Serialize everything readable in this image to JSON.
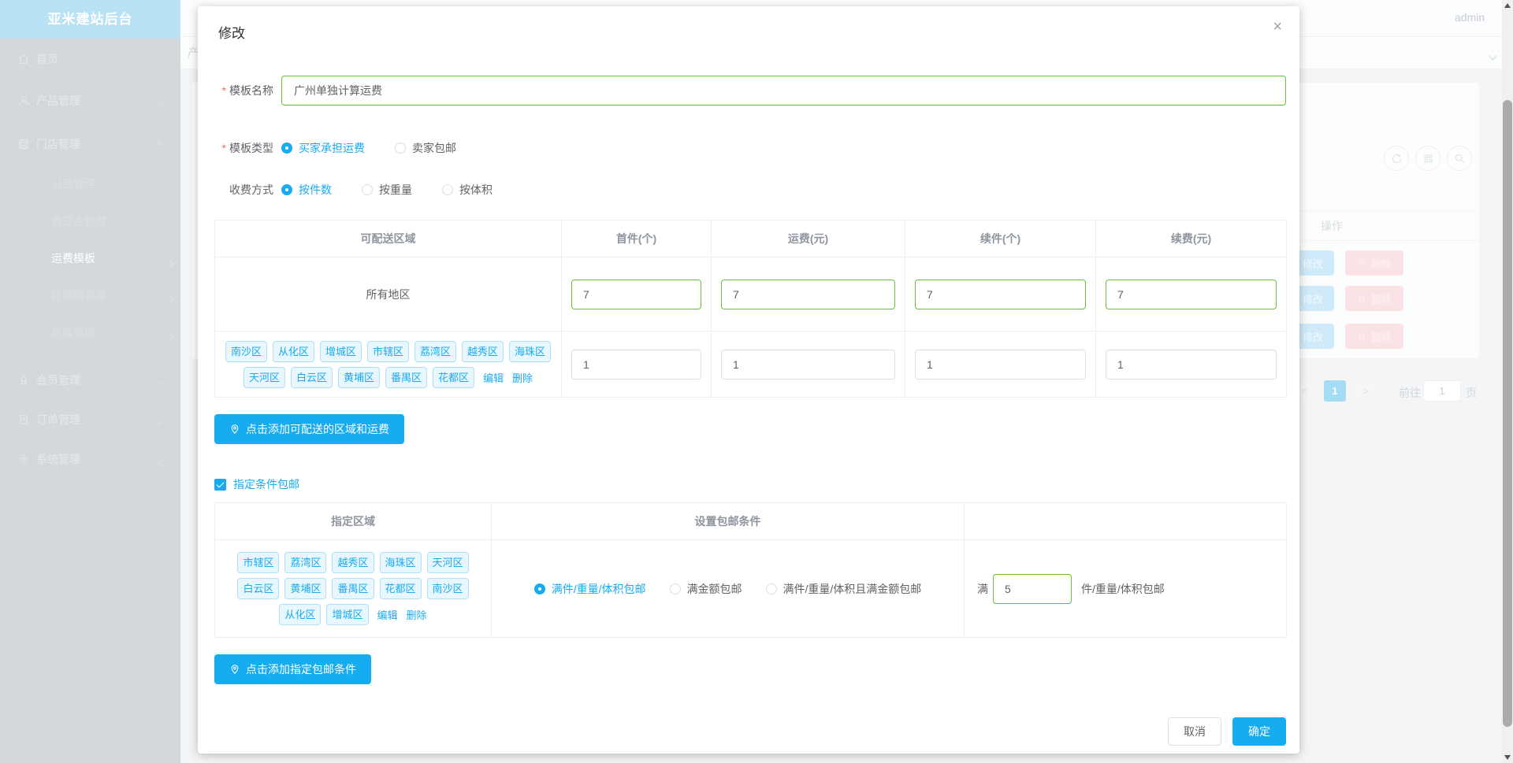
{
  "colors": {
    "primary": "#17acf0",
    "valid_green": "#67c23a",
    "tag_bg": "#e8f6fd",
    "sidebar_header_bg": "#b9e2f4"
  },
  "sidebar": {
    "title": "亚米建站后台",
    "items": [
      {
        "label": "首页"
      },
      {
        "label": "产品管理"
      },
      {
        "label": "门店管理"
      },
      {
        "label": "会员管理"
      },
      {
        "label": "订单管理"
      },
      {
        "label": "系统管理"
      }
    ],
    "store_submenu": [
      "公告管理",
      "自提点管理",
      "运费模板",
      "轮播图管理",
      "热搜管理"
    ],
    "active_item": "运费模板"
  },
  "background": {
    "username": "admin",
    "breadcrumb_partial": "产",
    "operations_header": "操作",
    "row_buttons": {
      "edit": "修改",
      "delete": "删除"
    },
    "pagination": {
      "prev": "<",
      "current": "1",
      "next": ">",
      "goto_label": "前往",
      "goto_value": "1",
      "unit": "页"
    }
  },
  "modal": {
    "title": "修改",
    "close": "×",
    "name_field": {
      "label": "模板名称",
      "value": "广州单独计算运费"
    },
    "type_field": {
      "label": "模板类型",
      "options": [
        {
          "label": "买家承担运费",
          "selected": true
        },
        {
          "label": "卖家包邮",
          "selected": false
        }
      ]
    },
    "method_field": {
      "label": "收费方式",
      "options": [
        {
          "label": "按件数",
          "selected": true
        },
        {
          "label": "按重量",
          "selected": false
        },
        {
          "label": "按体积",
          "selected": false
        }
      ]
    },
    "shipping_table": {
      "headers": [
        "可配送区域",
        "首件(个)",
        "运费(元)",
        "续件(个)",
        "续费(元)"
      ],
      "row_all": {
        "region": "所有地区",
        "first": "7",
        "fee": "7",
        "additional": "7",
        "additional_fee": "7"
      },
      "row_regions": {
        "tags_line1": [
          "南沙区",
          "从化区",
          "增城区",
          "市辖区",
          "荔湾区",
          "越秀区",
          "海珠区"
        ],
        "tags_line2": [
          "天河区",
          "白云区",
          "黄埔区",
          "番禺区",
          "花都区"
        ],
        "edit": "编辑",
        "delete": "删除",
        "first": "1",
        "fee": "1",
        "additional": "1",
        "additional_fee": "1"
      }
    },
    "add_region_button": "点击添加可配送的区域和运费",
    "free_condition_checkbox": "指定条件包邮",
    "condition_table": {
      "headers": [
        "指定区域",
        "设置包邮条件"
      ],
      "tags_line1": [
        "市辖区",
        "荔湾区",
        "越秀区",
        "海珠区",
        "天河区"
      ],
      "tags_line2": [
        "白云区",
        "黄埔区",
        "番禺区",
        "花都区",
        "南沙区"
      ],
      "tags_line3": [
        "从化区",
        "增城区"
      ],
      "edit": "编辑",
      "delete": "删除",
      "options": [
        {
          "label": "满件/重量/体积包邮",
          "selected": true
        },
        {
          "label": "满金额包邮",
          "selected": false
        },
        {
          "label": "满件/重量/体积且满金额包邮",
          "selected": false
        }
      ],
      "threshold": {
        "prefix": "满",
        "value": "5",
        "suffix": "件/重量/体积包邮"
      }
    },
    "add_condition_button": "点击添加指定包邮条件",
    "footer": {
      "cancel": "取消",
      "confirm": "确定"
    }
  }
}
